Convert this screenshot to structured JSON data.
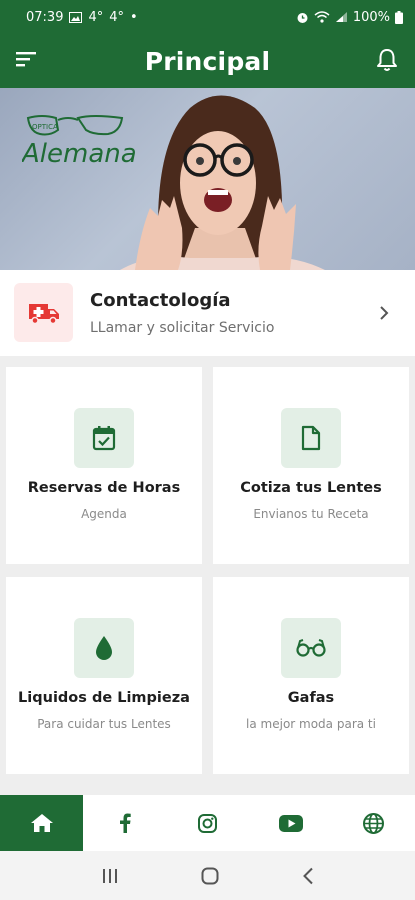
{
  "status_bar": {
    "time": "07:39",
    "temp1": "4°",
    "temp2": "4°",
    "dot": "•",
    "battery": "100%"
  },
  "app_bar": {
    "title": "Principal"
  },
  "banner": {
    "logo_text": "Alemana",
    "logo_small": "OPTICA"
  },
  "contact": {
    "title": "Contactología",
    "subtitle": "LLamar y solicitar Servicio"
  },
  "cards": [
    {
      "title": "Reservas de Horas",
      "subtitle": "Agenda",
      "icon": "calendar-check-icon"
    },
    {
      "title": "Cotiza tus Lentes",
      "subtitle": "Envianos tu Receta",
      "icon": "document-icon"
    },
    {
      "title": "Liquidos de Limpieza",
      "subtitle": "Para cuidar tus Lentes",
      "icon": "drop-icon"
    },
    {
      "title": "Gafas",
      "subtitle": "la mejor moda para ti",
      "icon": "glasses-icon"
    }
  ],
  "bottom_nav": [
    "home-icon",
    "facebook-icon",
    "instagram-icon",
    "youtube-icon",
    "globe-icon"
  ],
  "colors": {
    "primary": "#1f6b35",
    "accent_red": "#e53935",
    "icon_bg": "#e3efe6"
  }
}
